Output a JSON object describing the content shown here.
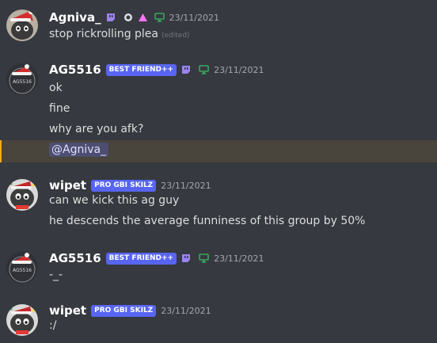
{
  "messages": [
    {
      "username": "Agniva_",
      "timestamp": "23/11/2021",
      "lines": [
        {
          "text": "stop rickrolling plea",
          "edited": "(edited)"
        }
      ]
    },
    {
      "username": "AG5516",
      "tag": "BEST FRIEND++",
      "avatar_text": "AG5516",
      "timestamp": "23/11/2021",
      "lines": [
        {
          "text": "ok"
        },
        {
          "text": "fine"
        },
        {
          "text": "why are you afk?"
        },
        {
          "mention": "@Agniva_"
        }
      ]
    },
    {
      "username": "wipet",
      "tag": "PRO GBI SKILZ",
      "timestamp": "23/11/2021",
      "lines": [
        {
          "text": "can we kick this ag guy"
        },
        {
          "text": "he descends the average funniness of this group by 50%"
        }
      ]
    },
    {
      "username": "AG5516",
      "tag": "BEST FRIEND++",
      "avatar_text": "AG5516",
      "timestamp": "23/11/2021",
      "lines": [
        {
          "text": "-_-"
        }
      ]
    },
    {
      "username": "wipet",
      "tag": "PRO GBI SKILZ",
      "timestamp": "23/11/2021",
      "lines": [
        {
          "text": ":/"
        }
      ]
    }
  ],
  "colors": {
    "background": "#36393f",
    "tag": "#5865f2",
    "mention_highlight": "#49443c",
    "mention_bar": "#faa81a",
    "desktop_status": "#3ba55d",
    "twitch_badge": "#9b84ec"
  },
  "icons": {
    "twitch_badge": "twitch-icon",
    "status": "desktop-monitor-icon",
    "extra_badges": [
      "hypesquad-icon",
      "nitro-triangle-icon"
    ]
  }
}
